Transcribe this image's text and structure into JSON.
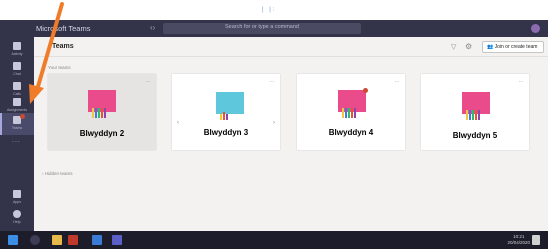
{
  "top": {
    "mark": "| |:"
  },
  "titlebar": {
    "app_title": "Microsoft Teams",
    "search_placeholder": "Search for or type a command"
  },
  "rail": {
    "items": [
      {
        "label": "Activity"
      },
      {
        "label": "Chat"
      },
      {
        "label": "Calls"
      },
      {
        "label": "Assignments"
      },
      {
        "label": "Teams"
      }
    ],
    "more": "...",
    "bottom": [
      {
        "label": "Apps"
      },
      {
        "label": "Help"
      }
    ]
  },
  "header": {
    "title": "Teams",
    "join_button": "Join or create team"
  },
  "sections": {
    "your_teams": "Your teams",
    "hidden_teams": "Hidden teams"
  },
  "teams": [
    {
      "name": "Blwyddyn 2",
      "more": "...",
      "thumb": "pink"
    },
    {
      "name": "Blwyddyn 3",
      "more": "...",
      "thumb": "blue"
    },
    {
      "name": "Blwyddyn 4",
      "more": "...",
      "thumb": "pink"
    },
    {
      "name": "Blwyddyn 5",
      "more": "...",
      "thumb": "pink"
    }
  ],
  "colors": {
    "accent": "#33344a",
    "annotation": "#f07c2a",
    "thumb_pink": "#e94b8b",
    "thumb_blue": "#5fc7dc"
  },
  "taskbar": {
    "time": "10:21",
    "date": "20/04/2020"
  }
}
